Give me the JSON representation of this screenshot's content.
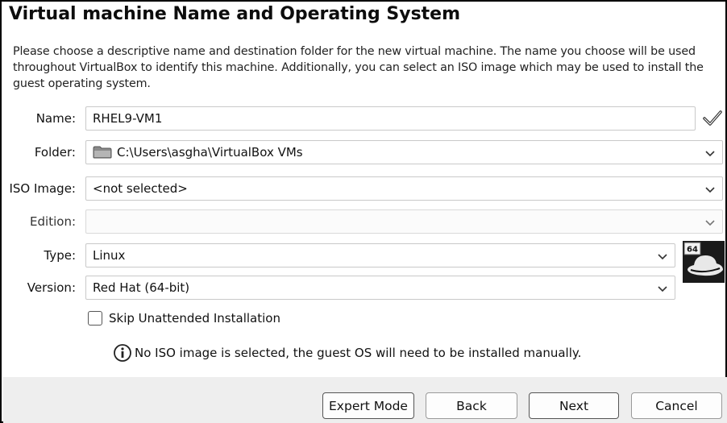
{
  "dialog": {
    "title": "Virtual machine Name and Operating System",
    "description": "Please choose a descriptive name and destination folder for the new virtual machine. The name you choose will be used throughout VirtualBox to identify this machine. Additionally, you can select an ISO image which may be used to install the guest operating system."
  },
  "form": {
    "name": {
      "label": "Name:",
      "value": "RHEL9-VM1"
    },
    "folder": {
      "label": "Folder:",
      "value": "C:\\Users\\asgha\\VirtualBox VMs"
    },
    "iso": {
      "label": "ISO Image:",
      "value": "<not selected>"
    },
    "edition": {
      "label": "Edition:",
      "value": ""
    },
    "type": {
      "label": "Type:",
      "value": "Linux"
    },
    "version": {
      "label": "Version:",
      "value": "Red Hat (64-bit)"
    },
    "os_icon_badge": "64",
    "skip_unattended": {
      "label": "Skip Unattended Installation",
      "checked": false
    },
    "info_message": "No ISO image is selected, the guest OS will need to be installed manually."
  },
  "buttons": {
    "expert": "Expert Mode",
    "back": "Back",
    "next": "Next",
    "cancel": "Cancel"
  },
  "icons": {
    "name_valid": "checkmark-icon",
    "folder": "folder-icon",
    "os": "redhat-os-icon",
    "info": "info-icon",
    "dropdown": "chevron-down-icon"
  }
}
